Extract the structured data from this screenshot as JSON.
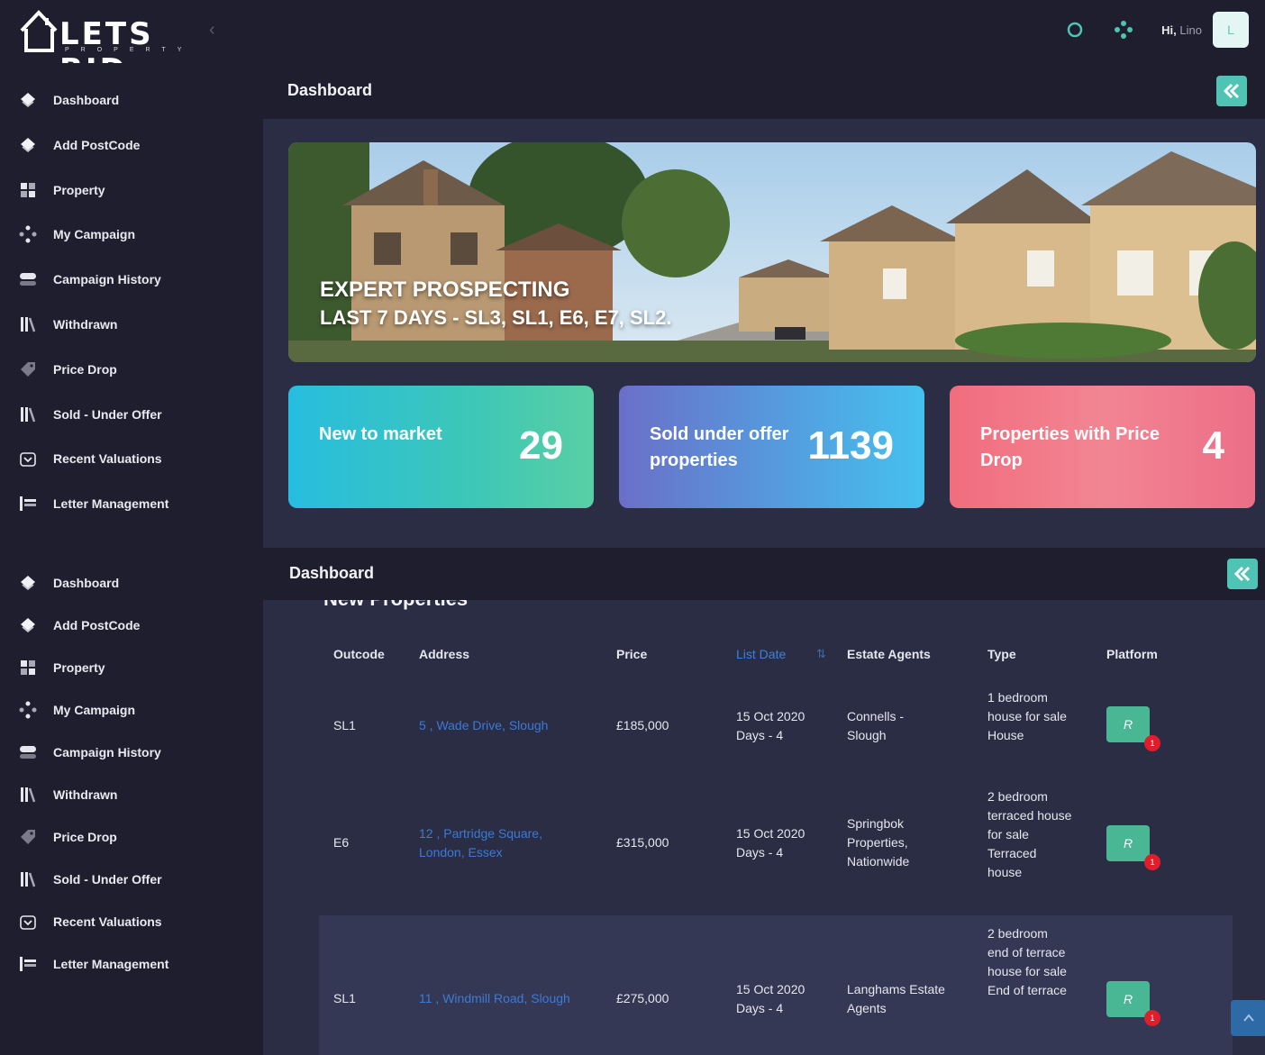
{
  "app": {
    "logo_text": "LETS BID",
    "logo_sub": "PROPERTY",
    "greeting": "Hi,",
    "user_name": "Lino",
    "avatar_letter": "L"
  },
  "sidebar": {
    "group1": [
      {
        "label": "Dashboard",
        "icon": "diamond-icon"
      },
      {
        "label": "Add PostCode",
        "icon": "diamond-icon"
      },
      {
        "label": "Property",
        "icon": "grid-icon"
      },
      {
        "label": "My Campaign",
        "icon": "network-icon"
      },
      {
        "label": "Campaign History",
        "icon": "toggle-icon"
      },
      {
        "label": "Withdrawn",
        "icon": "library-icon"
      },
      {
        "label": "Price Drop",
        "icon": "tag-icon"
      },
      {
        "label": "Sold - Under Offer",
        "icon": "library-icon"
      },
      {
        "label": "Recent Valuations",
        "icon": "download-icon"
      },
      {
        "label": "Letter Management",
        "icon": "list-icon"
      }
    ],
    "group2": [
      {
        "label": "Dashboard",
        "icon": "diamond-icon"
      },
      {
        "label": "Add PostCode",
        "icon": "diamond-icon"
      },
      {
        "label": "Property",
        "icon": "grid-icon"
      },
      {
        "label": "My Campaign",
        "icon": "network-icon"
      },
      {
        "label": "Campaign History",
        "icon": "toggle-icon"
      },
      {
        "label": "Withdrawn",
        "icon": "library-icon"
      },
      {
        "label": "Price Drop",
        "icon": "tag-icon"
      },
      {
        "label": "Sold - Under Offer",
        "icon": "library-icon"
      },
      {
        "label": "Recent Valuations",
        "icon": "download-icon"
      },
      {
        "label": "Letter Management",
        "icon": "list-icon"
      }
    ]
  },
  "main": {
    "title": "Dashboard",
    "banner": {
      "line1": "EXPERT PROSPECTING",
      "line2": "LAST 7 DAYS - SL3, SL1, E6, E7, SL2."
    },
    "stats": [
      {
        "label": "New to market",
        "value": "29"
      },
      {
        "label": "Sold under offer properties",
        "value": "1139"
      },
      {
        "label": "Properties with Price Drop",
        "value": "4"
      }
    ],
    "section2_title": "Dashboard",
    "table": {
      "title": "New Properties",
      "headers": [
        "Outcode",
        "Address",
        "Price",
        "List Date",
        "Estate Agents",
        "Type",
        "Platform"
      ],
      "rows": [
        {
          "outcode": "SL1",
          "address": "5 , Wade Drive, Slough",
          "price": "£185,000",
          "list_date": "15 Oct 2020",
          "days": "Days - 4",
          "agent": "Connells - Slough",
          "type": "1 bedroom house for sale House",
          "platform": "R",
          "badge": "1"
        },
        {
          "outcode": "E6",
          "address": "12 , Partridge Square, London, Essex",
          "price": "£315,000",
          "list_date": "15 Oct 2020",
          "days": "Days - 4",
          "agent": "Springbok Properties, Nationwide",
          "type": "2 bedroom terraced house for sale Terraced house",
          "platform": "R",
          "badge": "1"
        },
        {
          "outcode": "SL1",
          "address": "11 , Windmill Road, Slough",
          "price": "£275,000",
          "list_date": "15 Oct 2020",
          "days": "Days - 4",
          "agent": "Langhams Estate Agents",
          "type": "2 bedroom end of terrace house for sale End of terrace",
          "platform": "R",
          "badge": "1"
        }
      ]
    }
  },
  "colors": {
    "bg_dark": "#1f1e2e",
    "bg_main": "#2b2d44",
    "accent": "#4fc3b4",
    "link": "#3b7ad6"
  }
}
